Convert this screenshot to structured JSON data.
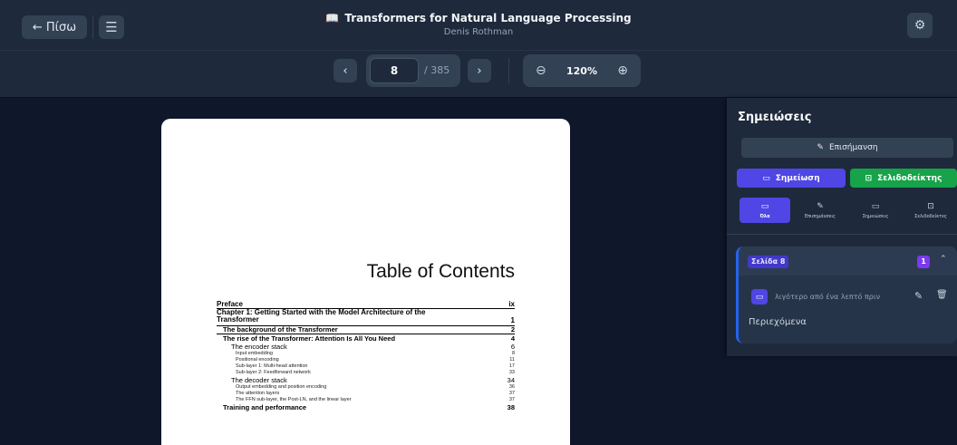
{
  "header": {
    "back_label": "← Πίσω",
    "menu_icon": "☰",
    "book_title": "Transformers for Natural Language Processing",
    "book_icon": "📖",
    "author": "Denis Rothman",
    "settings_icon": "⚙"
  },
  "nav": {
    "prev_icon": "‹",
    "current_page": "8",
    "total_pages": "/ 385",
    "next_icon": "›",
    "zoom_out_icon": "⊖",
    "zoom_level": "120%",
    "zoom_in_icon": "⊕"
  },
  "document": {
    "toc_title": "Table of Contents",
    "preface": {
      "title": "Preface",
      "page": "ix"
    },
    "chapter": {
      "title": "Chapter 1: Getting Started with the Model Architecture of the Transformer",
      "page": "1"
    },
    "entries": [
      {
        "level": "l1",
        "title": "The background of the Transformer",
        "page": "2"
      },
      {
        "level": "l1",
        "title": "The rise of the Transformer: Attention Is All You Need",
        "page": "4"
      },
      {
        "level": "l2",
        "title": "The encoder stack",
        "page": "6"
      },
      {
        "level": "l3",
        "title": "Input embedding",
        "page": "8"
      },
      {
        "level": "l3",
        "title": "Positional encoding",
        "page": "11"
      },
      {
        "level": "l3",
        "title": "Sub-layer 1: Multi-head attention",
        "page": "17"
      },
      {
        "level": "l3",
        "title": "Sub-layer 2: Feedforward network",
        "page": "33"
      },
      {
        "level": "l2",
        "title": "The decoder stack",
        "page": "34"
      },
      {
        "level": "l3",
        "title": "Output embedding and position encoding",
        "page": "36"
      },
      {
        "level": "l3",
        "title": "The attention layers",
        "page": "37"
      },
      {
        "level": "l3",
        "title": "The FFN sub-layer, the Post-LN, and the linear layer",
        "page": "37"
      },
      {
        "level": "l1",
        "title": "Training and performance",
        "page": "38"
      }
    ]
  },
  "sidebar": {
    "title": "Σημειώσεις",
    "highlight_label": "Επισήμανση",
    "highlight_icon": "✎",
    "note_label": "Σημείωση",
    "note_icon": "▭",
    "bookmark_label": "Σελιδοδείκτης",
    "bookmark_icon": "⊡",
    "filters": [
      {
        "label": "Όλα",
        "icon": "▭"
      },
      {
        "label": "Επισημάνσεις",
        "icon": "✎"
      },
      {
        "label": "Σημειώσεις",
        "icon": "▭"
      },
      {
        "label": "Σελιδοδείκτες",
        "icon": "⊡"
      }
    ],
    "group": {
      "page_label": "Σελίδα 8",
      "count": "1",
      "collapse_icon": "⌃",
      "note_time": "λιγότερο από ένα λεπτό πριν",
      "note_text": "Περιεχόμενα",
      "edit_icon": "✎",
      "delete_icon": "🗑"
    }
  },
  "colors": {
    "accent_indigo": "#4f46e5",
    "accent_green": "#16a34a",
    "bg_dark": "#0f172a",
    "panel": "#1e293b"
  }
}
